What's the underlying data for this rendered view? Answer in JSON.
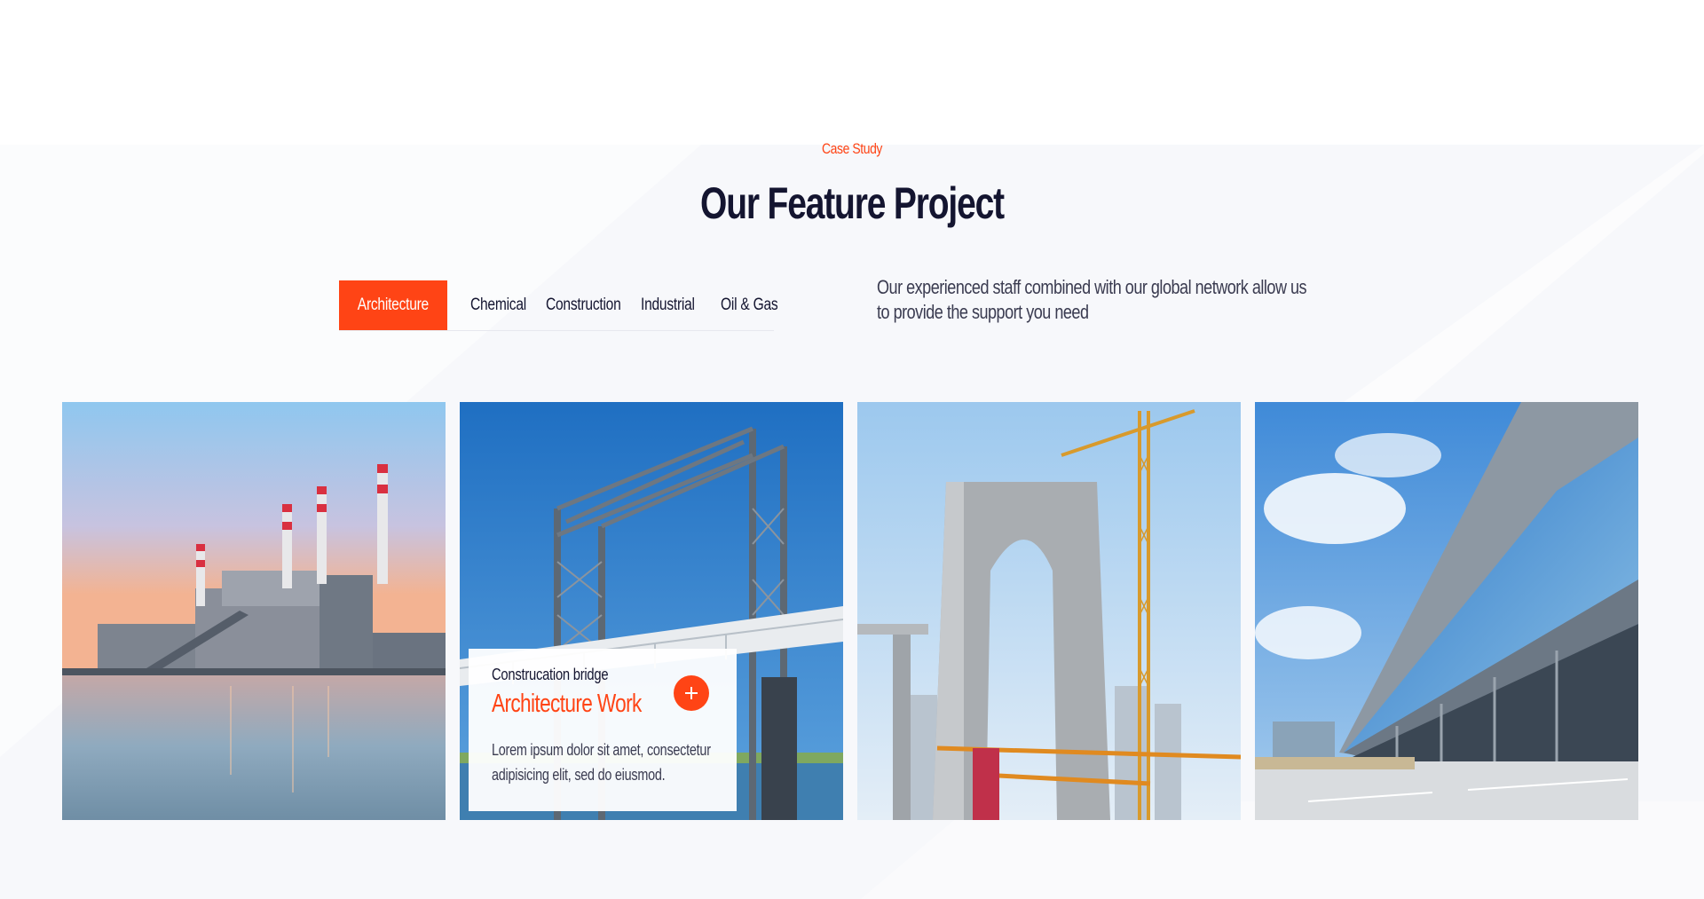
{
  "section": {
    "eyebrow": "Case Study",
    "title": "Our Feature Project",
    "description": "Our experienced staff combined with our global network allow us to provide the support you need"
  },
  "tabs": [
    {
      "label": "Architecture",
      "active": true
    },
    {
      "label": "Chemical",
      "active": false
    },
    {
      "label": "Construction",
      "active": false
    },
    {
      "label": "Industrial",
      "active": false
    },
    {
      "label": "Oil & Gas",
      "active": false
    }
  ],
  "projects": [
    {
      "image": "power-plant-photo"
    },
    {
      "image": "steel-bridge-photo",
      "subtitle": "Construcation bridge",
      "title": "Architecture Work",
      "text": "Lorem ipsum dolor sit amet, consectetur adipisicing elit, sed do eiusmod.",
      "icon": "plus-icon"
    },
    {
      "image": "bridge-tower-crane-photo"
    },
    {
      "image": "glass-building-photo"
    }
  ],
  "colors": {
    "accent": "#ff4415",
    "heading": "#141530",
    "band": "#f7f8fb"
  }
}
